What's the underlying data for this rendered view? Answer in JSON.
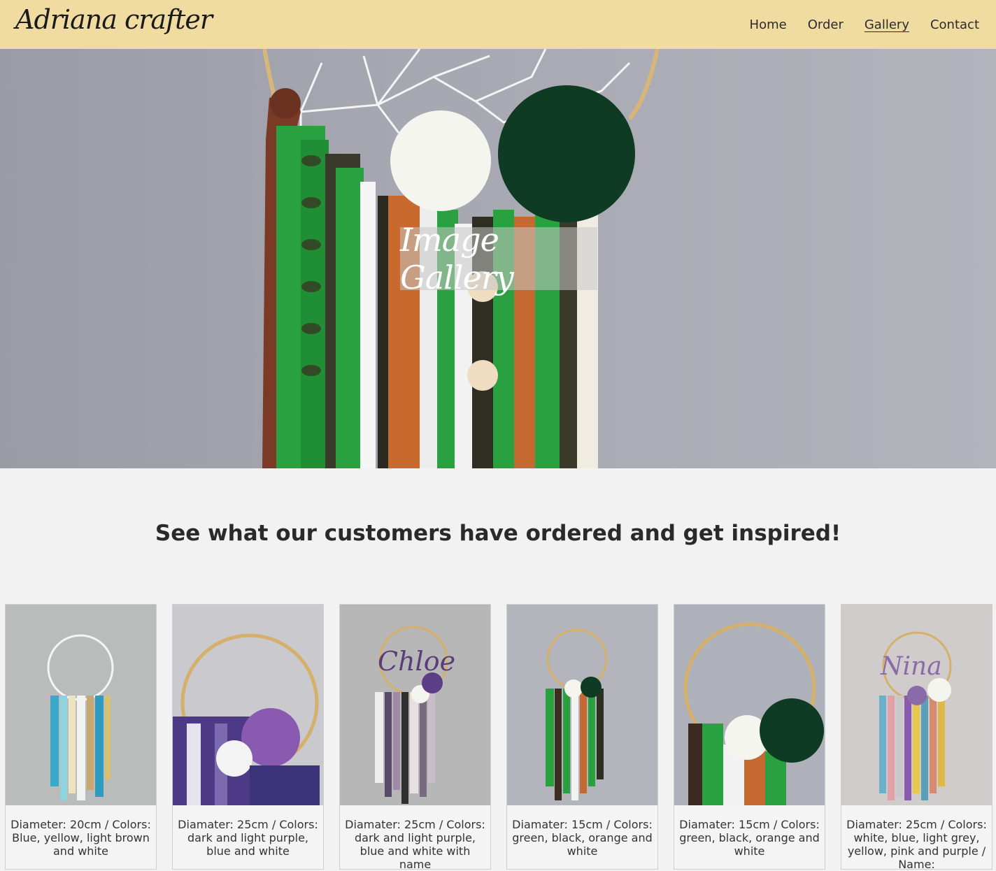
{
  "brand": {
    "logo_text": "Adriana crafter"
  },
  "nav": {
    "items": [
      {
        "label": "Home",
        "active": false
      },
      {
        "label": "Order",
        "active": false
      },
      {
        "label": "Gallery",
        "active": true
      },
      {
        "label": "Contact",
        "active": false
      }
    ]
  },
  "hero": {
    "title": "Image Gallery"
  },
  "main": {
    "tagline": "See what our customers have ordered and get inspired!"
  },
  "gallery": {
    "items": [
      {
        "caption": "Diameter: 20cm / Colors: Blue, yellow, light brown and white"
      },
      {
        "caption": "Diamater: 25cm / Colors: dark and light purple, blue and white"
      },
      {
        "caption": "Diamater: 25cm / Colors: dark and light purple, blue and white with name"
      },
      {
        "caption": "Diamater: 15cm / Colors: green, black, orange and white"
      },
      {
        "caption": "Diamater: 15cm / Colors: green, black, orange and white"
      },
      {
        "caption": "Diamater: 25cm / Colors: white, blue, light grey, yellow, pink and purple / Name:"
      }
    ]
  },
  "colors": {
    "navbar": "#f0dca0",
    "page_background": "#f2f2f2"
  }
}
